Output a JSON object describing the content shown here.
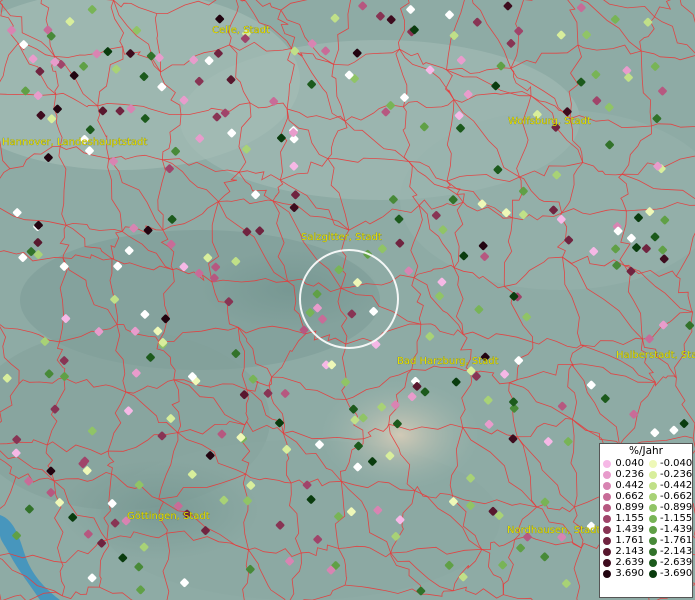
{
  "cities": [
    {
      "name": "Celle, Stadt"
    },
    {
      "name": "Hannover, Landeshauptstadt"
    },
    {
      "name": "Wolfsburg, Stadt"
    },
    {
      "name": "Salzgitter, Stadt"
    },
    {
      "name": "Bad Harzburg, Stadt"
    },
    {
      "name": "Halberstadt, Stadt"
    },
    {
      "name": "Göttingen, Stadt"
    },
    {
      "name": "Nordhausen, Stadt"
    }
  ],
  "legend": {
    "title": "%/Jahr",
    "positive": [
      "0.040",
      "0.236",
      "0.442",
      "0.662",
      "0.899",
      "1.155",
      "1.439",
      "1.761",
      "2.143",
      "2.639",
      "3.690"
    ],
    "negative": [
      "-0.040",
      "-0.236",
      "-0.442",
      "-0.662",
      "-0.899",
      "-1.155",
      "-1.439",
      "-1.761",
      "-2.143",
      "-2.639",
      "-3.690"
    ],
    "positive_colors": [
      "#f6b8e6",
      "#e89ccc",
      "#d884b2",
      "#c86c98",
      "#b65880",
      "#a0446a",
      "#883454",
      "#702440",
      "#58182e",
      "#3e0c1e",
      "#220410"
    ],
    "negative_colors": [
      "#eef8b8",
      "#d8ee9c",
      "#c0e088",
      "#a8d276",
      "#90c466",
      "#78b456",
      "#60a046",
      "#488a38",
      "#32722a",
      "#1c5a1c",
      "#0a3c0e"
    ]
  },
  "colors": {
    "borders": "#e83a3a",
    "river": "#3f93c0",
    "selection_ring": "#ffffff",
    "city_label": "#e8e000"
  }
}
